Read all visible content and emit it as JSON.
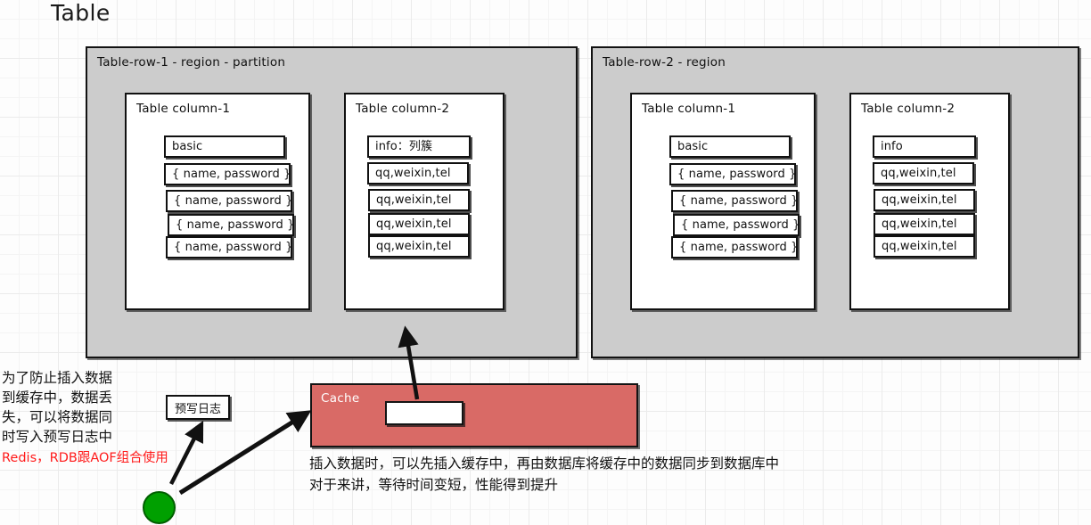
{
  "page": {
    "title": "Table",
    "background": "#fdfdfd",
    "grid_color": "#ebebeb"
  },
  "regions": [
    {
      "name": "table-row-1",
      "label": "Table-row-1 - region - partition",
      "fill": "#cccccc",
      "columns": [
        {
          "label": "Table column-1",
          "cells": [
            "basic",
            "{ name, password }",
            "{ name, password }",
            "{ name, password }",
            "{ name, password }"
          ]
        },
        {
          "label": "Table column-2",
          "cells": [
            "info：列簇",
            "qq,weixin,tel",
            "qq,weixin,tel",
            "qq,weixin,tel",
            "qq,weixin,tel"
          ]
        }
      ]
    },
    {
      "name": "table-row-2",
      "label": "Table-row-2 - region",
      "fill": "#cccccc",
      "columns": [
        {
          "label": "Table column-1",
          "cells": [
            "basic",
            "{ name, password }",
            "{ name, password }",
            "{ name, password }",
            "{ name, password }"
          ]
        },
        {
          "label": "Table column-2",
          "cells": [
            "info",
            "qq,weixin,tel",
            "qq,weixin,tel",
            "qq,weixin,tel",
            "qq,weixin,tel"
          ]
        }
      ]
    }
  ],
  "cache": {
    "label": "Cache",
    "fill": "#d96a66",
    "slot_value": ""
  },
  "wal": {
    "label": "预写日志"
  },
  "notes": {
    "left": "为了防止插入数据\n到缓存中，数据丢\n失，可以将数据同\n时写入预写日志中",
    "left_red": "Redis，RDB跟AOF组合使用",
    "left_red_color": "#ff1a1a",
    "bottom": "插入数据时，可以先插入缓存中，再由数据库将缓存中的数据同步到数据库中\n对于来讲，等待时间变短，性能得到提升"
  },
  "node": {
    "name": "client-node",
    "color": "#00a000"
  }
}
